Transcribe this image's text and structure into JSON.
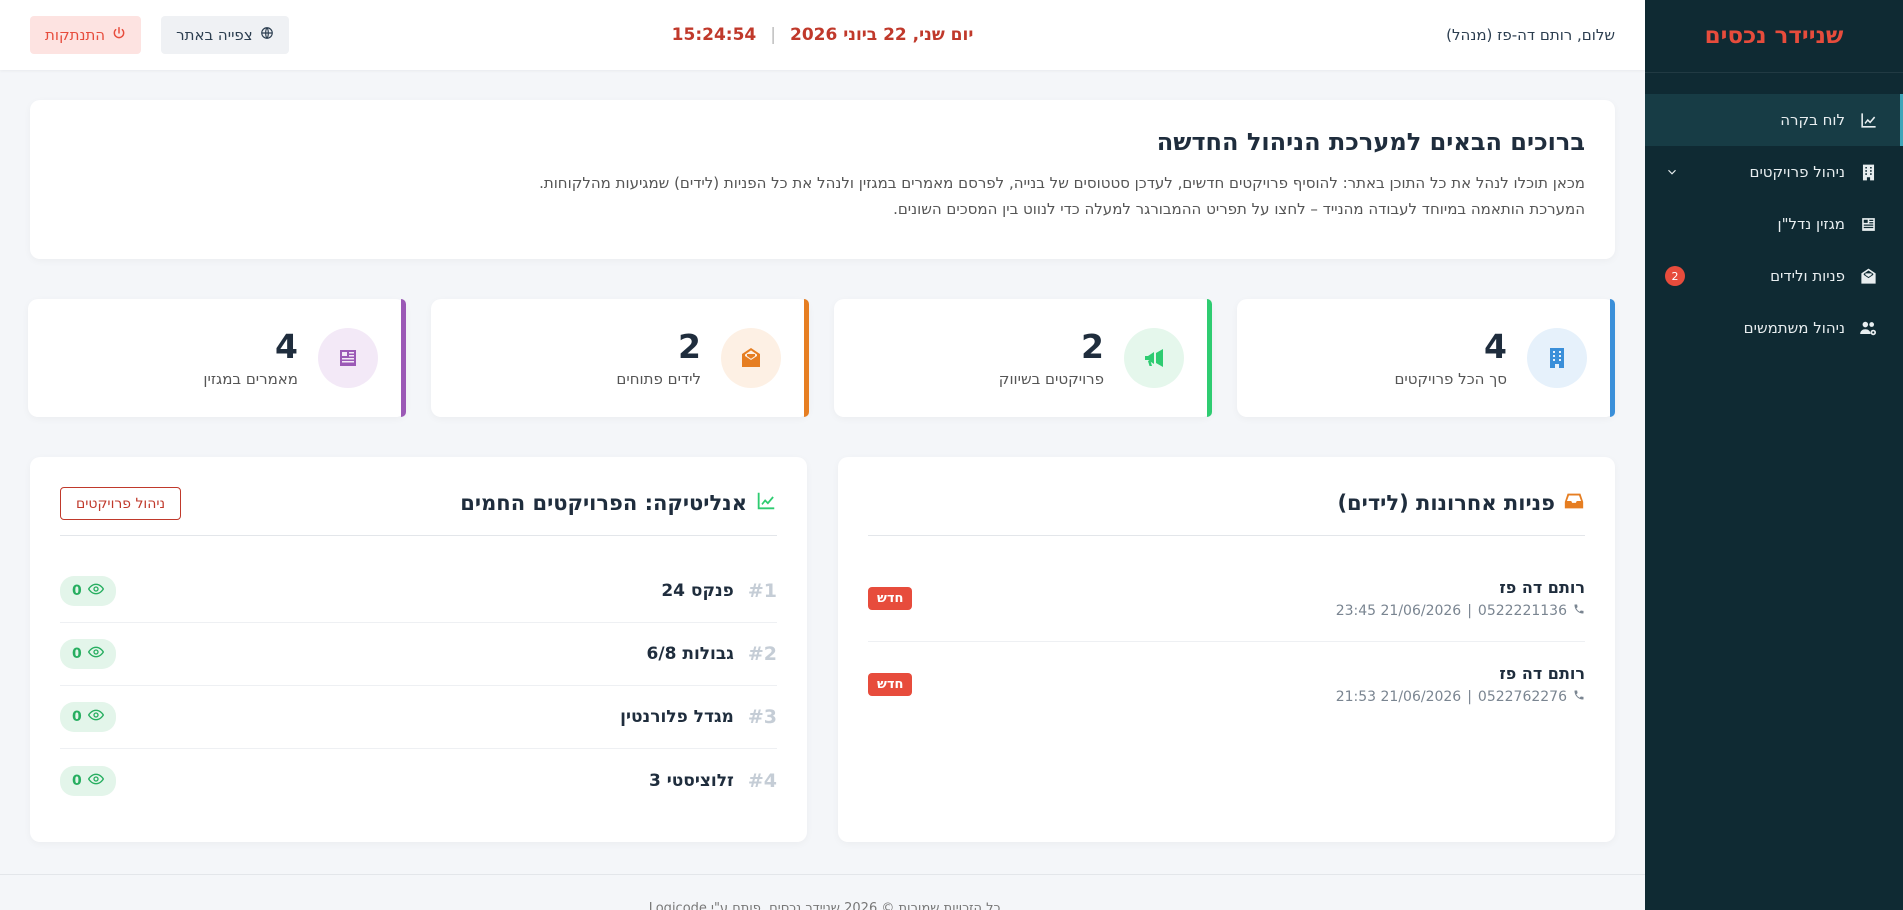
{
  "sidebar": {
    "brand": "שניידר נכסים",
    "items": [
      {
        "label": "לוח בקרה",
        "icon": "chart-line-icon",
        "active": true
      },
      {
        "label": "ניהול פרויקטים",
        "icon": "building-icon",
        "has_submenu": true
      },
      {
        "label": "מגזין נדל\"ן",
        "icon": "newspaper-icon"
      },
      {
        "label": "פניות ולידים",
        "icon": "envelope-open-icon",
        "badge": "2"
      },
      {
        "label": "ניהול משתמשים",
        "icon": "users-gear-icon"
      }
    ]
  },
  "topbar": {
    "greeting": "שלום, רותם דה-פז (מנהל)",
    "date": "יום שני, 22 ביוני 2026",
    "time": "15:24:54",
    "view_site_label": "צפייה באתר",
    "logout_label": "התנתקות"
  },
  "welcome": {
    "title": "ברוכים הבאים למערכת הניהול החדשה",
    "line1": "מכאן תוכלו לנהל את כל התוכן באתר: להוסיף פרויקטים חדשים, לעדכן סטטוסים של בנייה, לפרסם מאמרים במגזין ולנהל את כל הפניות (לידים) שמגיעות מהלקוחות.",
    "line2": "המערכת הותאמה במיוחד לעבודה מהנייד – לחצו על תפריט ההמבורגר למעלה כדי לנווט בין המסכים השונים."
  },
  "stats": [
    {
      "value": "4",
      "label": "סך הכל פרויקטים",
      "icon": "building-icon",
      "color": "#3a8fd9",
      "bg": "#e6f1fb"
    },
    {
      "value": "2",
      "label": "פרויקטים בשיווק",
      "icon": "megaphone-icon",
      "color": "#2ecc71",
      "bg": "#e5f7ec"
    },
    {
      "value": "2",
      "label": "לידים פתוחים",
      "icon": "envelope-open-icon",
      "color": "#e67e22",
      "bg": "#fdf0e4"
    },
    {
      "value": "4",
      "label": "מאמרים במגזין",
      "icon": "newspaper-icon",
      "color": "#9b59b6",
      "bg": "#f3e9f7"
    }
  ],
  "leads": {
    "title": "פניות אחרונות (לידים)",
    "items": [
      {
        "name": "רותם דה פז",
        "phone": "0522221136",
        "datetime": "21/06/2026 23:45",
        "badge": "חדש"
      },
      {
        "name": "רותם דה פז",
        "phone": "0522762276",
        "datetime": "21/06/2026 21:53",
        "badge": "חדש"
      }
    ]
  },
  "analytics": {
    "title": "אנליטיקה: הפרויקטים החמים",
    "manage_label": "ניהול פרויקטים",
    "items": [
      {
        "rank": "#1",
        "name": "פנקס 24",
        "views": "0"
      },
      {
        "rank": "#2",
        "name": "גבולות 6/8",
        "views": "0"
      },
      {
        "rank": "#3",
        "name": "מגדל פלורנטין",
        "views": "0"
      },
      {
        "rank": "#4",
        "name": "זלוציסטי 3",
        "views": "0"
      }
    ]
  },
  "footer": {
    "text": "כל הזכויות שמורות © 2026 שניידר נכסים. פותח ע\"י Logicode."
  }
}
